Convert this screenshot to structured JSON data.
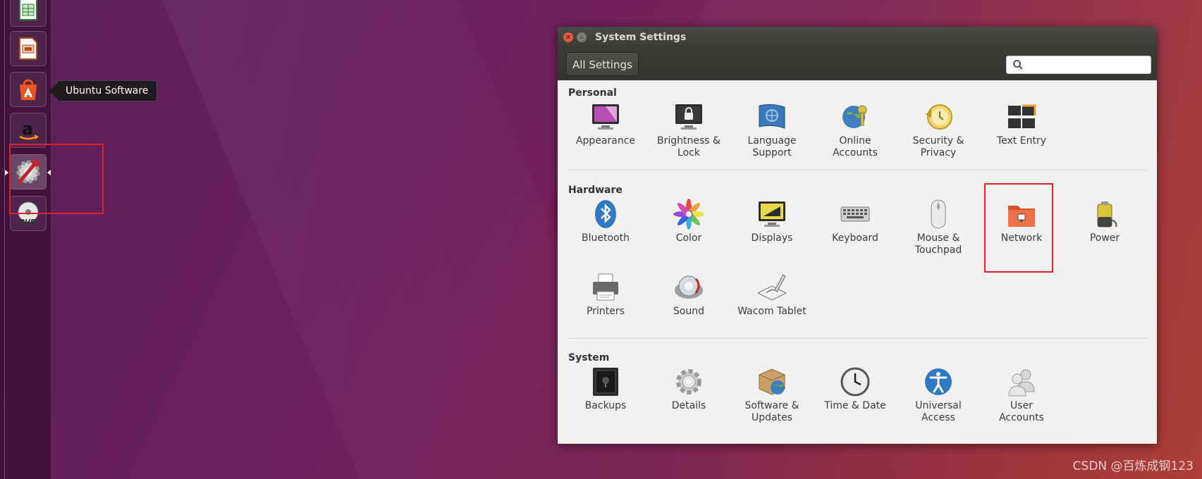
{
  "launcher": {
    "tooltip": "Ubuntu Software",
    "apps": [
      {
        "name": "libreoffice-calc-icon"
      },
      {
        "name": "libreoffice-impress-icon"
      },
      {
        "name": "ubuntu-software-icon"
      },
      {
        "name": "amazon-icon"
      },
      {
        "name": "system-settings-icon"
      },
      {
        "name": "dvd-icon"
      }
    ]
  },
  "window": {
    "title": "System Settings",
    "all_settings": "All Settings",
    "search_placeholder": ""
  },
  "sections": {
    "personal": {
      "title": "Personal",
      "items": [
        "Appearance",
        "Brightness &\nLock",
        "Language\nSupport",
        "Online\nAccounts",
        "Security &\nPrivacy",
        "Text Entry"
      ]
    },
    "hardware": {
      "title": "Hardware",
      "items": [
        "Bluetooth",
        "Color",
        "Displays",
        "Keyboard",
        "Mouse &\nTouchpad",
        "Network",
        "Power",
        "Printers",
        "Sound",
        "Wacom Tablet"
      ]
    },
    "system": {
      "title": "System",
      "items": [
        "Backups",
        "Details",
        "Software &\nUpdates",
        "Time & Date",
        "Universal\nAccess",
        "User\nAccounts"
      ]
    }
  },
  "watermark": "CSDN @百炼成钢123",
  "colors": {
    "highlight": "#e0202a",
    "titlebar": "#3c3b37",
    "accent": "#e95420"
  }
}
